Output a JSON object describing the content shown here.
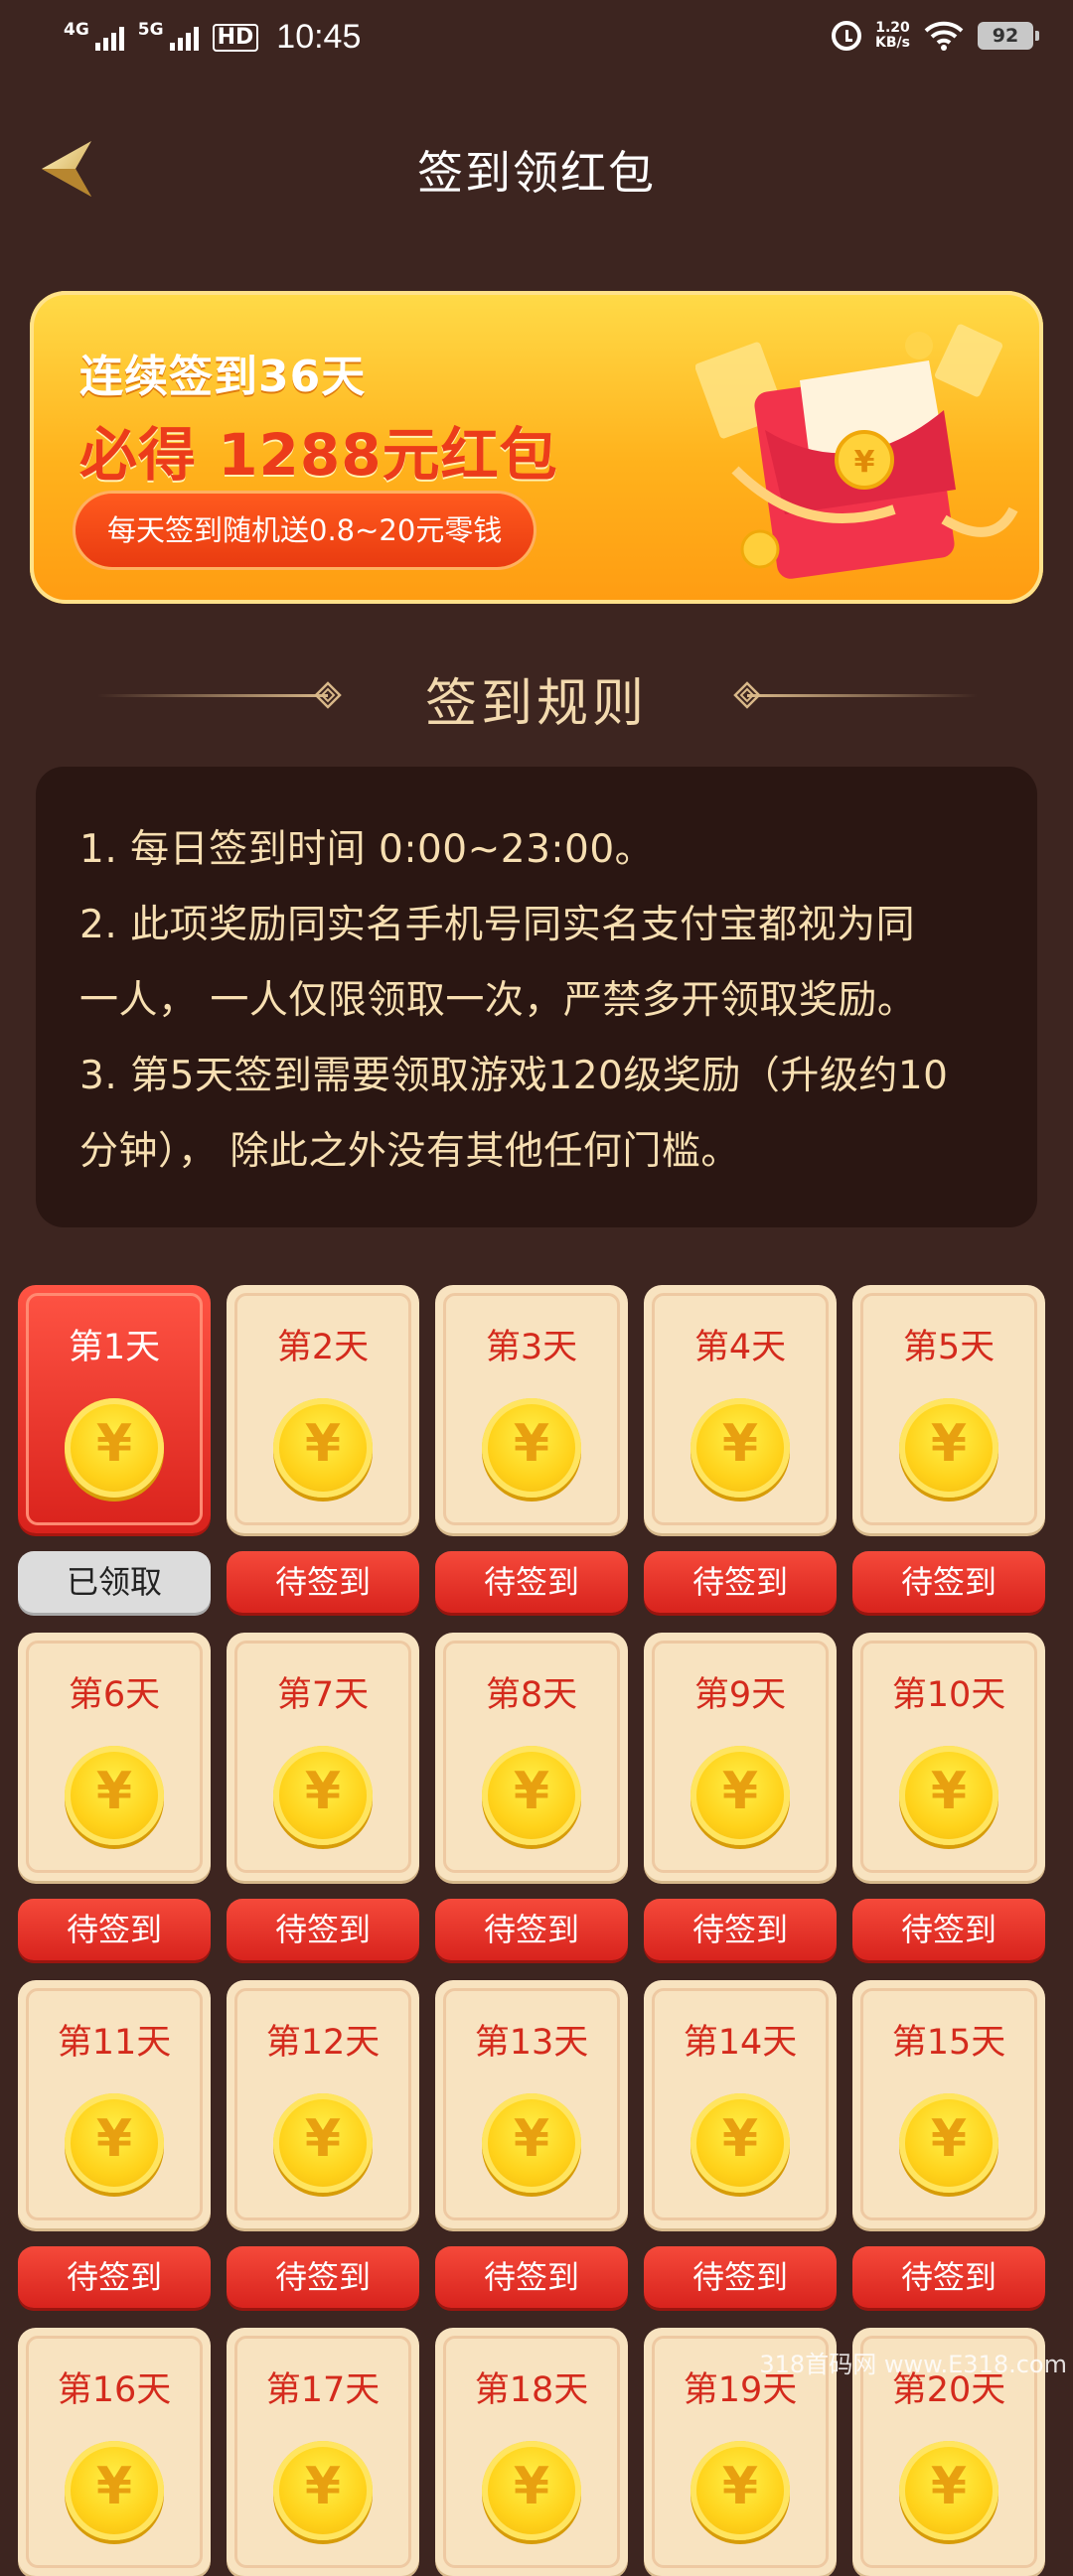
{
  "status_bar": {
    "net1": "4G",
    "net2": "5G",
    "hd": "HD",
    "time": "10:45",
    "speed_value": "1.20",
    "speed_unit": "KB/s",
    "battery": "92"
  },
  "header": {
    "title": "签到领红包"
  },
  "banner": {
    "line1": "连续签到36天",
    "line2": "必得 1288元红包",
    "pill": "每天签到随机送0.8~20元零钱"
  },
  "rules": {
    "title": "签到规则",
    "lines": [
      "1. 每日签到时间 0:00~23:00。",
      "2. 此项奖励同实名手机号同实名支付宝都视为同",
      "一人， 一人仅限领取一次，严禁多开领取奖励。",
      "3. 第5天签到需要领取游戏120级奖励（升级约10",
      "分钟）， 除此之外没有其他任何门槛。"
    ]
  },
  "coin_symbol": "¥",
  "days": [
    {
      "label": "第1天",
      "status": "已领取",
      "claimed": true
    },
    {
      "label": "第2天",
      "status": "待签到",
      "claimed": false
    },
    {
      "label": "第3天",
      "status": "待签到",
      "claimed": false
    },
    {
      "label": "第4天",
      "status": "待签到",
      "claimed": false
    },
    {
      "label": "第5天",
      "status": "待签到",
      "claimed": false
    },
    {
      "label": "第6天",
      "status": "待签到",
      "claimed": false
    },
    {
      "label": "第7天",
      "status": "待签到",
      "claimed": false
    },
    {
      "label": "第8天",
      "status": "待签到",
      "claimed": false
    },
    {
      "label": "第9天",
      "status": "待签到",
      "claimed": false
    },
    {
      "label": "第10天",
      "status": "待签到",
      "claimed": false
    },
    {
      "label": "第11天",
      "status": "待签到",
      "claimed": false
    },
    {
      "label": "第12天",
      "status": "待签到",
      "claimed": false
    },
    {
      "label": "第13天",
      "status": "待签到",
      "claimed": false
    },
    {
      "label": "第14天",
      "status": "待签到",
      "claimed": false
    },
    {
      "label": "第15天",
      "status": "待签到",
      "claimed": false
    },
    {
      "label": "第16天",
      "status": "",
      "claimed": false
    },
    {
      "label": "第17天",
      "status": "",
      "claimed": false
    },
    {
      "label": "第18天",
      "status": "",
      "claimed": false
    },
    {
      "label": "第19天",
      "status": "",
      "claimed": false
    },
    {
      "label": "第20天",
      "status": "",
      "claimed": false
    }
  ],
  "watermark": "318首码网 www.E318.com",
  "colors": {
    "background": "#3d2520",
    "card_bg": "#2a1612",
    "accent_red": "#d8231d",
    "banner_orange": "#ffb21c",
    "rule_text": "#f7dfb2"
  }
}
